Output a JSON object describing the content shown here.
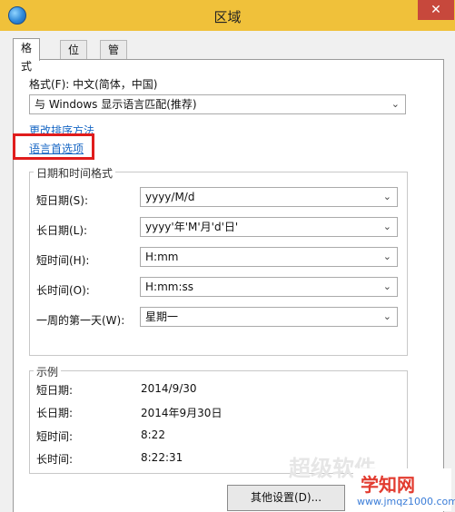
{
  "window": {
    "title": "区域",
    "close_glyph": "✕",
    "app_icon": "globe-icon"
  },
  "tabs": [
    {
      "label": "格式",
      "active": true
    },
    {
      "label": "位置",
      "active": false
    },
    {
      "label": "管理",
      "active": false
    }
  ],
  "format": {
    "label": "格式(F): 中文(简体，中国)",
    "selected": "与 Windows 显示语言匹配(推荐)"
  },
  "links": {
    "sort_method": "更改排序方法",
    "language_prefs": "语言首选项"
  },
  "datetime": {
    "legend": "日期和时间格式",
    "rows": [
      {
        "label": "短日期(S):",
        "value": "yyyy/M/d"
      },
      {
        "label": "长日期(L):",
        "value": "yyyy'年'M'月'd'日'"
      },
      {
        "label": "短时间(H):",
        "value": "H:mm"
      },
      {
        "label": "长时间(O):",
        "value": "H:mm:ss"
      },
      {
        "label": "一周的第一天(W):",
        "value": "星期一"
      }
    ]
  },
  "examples": {
    "legend": "示例",
    "rows": [
      {
        "label": "短日期:",
        "value": "2014/9/30"
      },
      {
        "label": "长日期:",
        "value": "2014年9月30日"
      },
      {
        "label": "短时间:",
        "value": "8:22"
      },
      {
        "label": "长时间:",
        "value": "8:22:31"
      }
    ]
  },
  "buttons": {
    "other_settings": "其他设置(D)..."
  },
  "watermark": {
    "brand": "学知网",
    "url": "www.jmqz1000.com",
    "faint": "超级软件"
  },
  "colors": {
    "titlebar": "#f0c13a",
    "highlight_box": "#e01c1c",
    "link": "#1666c4"
  }
}
